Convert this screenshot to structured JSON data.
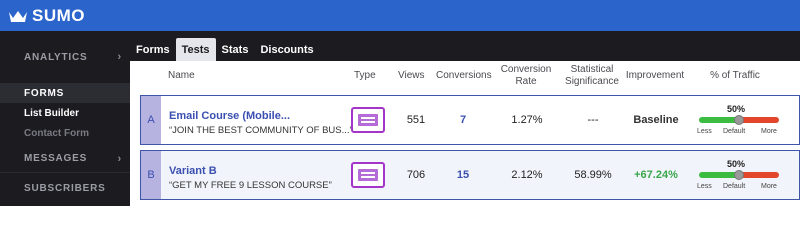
{
  "brand": {
    "name": "SUMO",
    "icon": "crown-icon"
  },
  "sidebar": {
    "analytics": "ANALYTICS",
    "forms": "FORMS",
    "list_builder": "List Builder",
    "contact_form": "Contact Form",
    "messages": "MESSAGES",
    "subscribers": "SUBSCRIBERS"
  },
  "tabs": [
    "Forms",
    "Tests",
    "Stats",
    "Discounts"
  ],
  "active_tab": "Tests",
  "table": {
    "headers": {
      "name": "Name",
      "type": "Type",
      "views": "Views",
      "conversions": "Conversions",
      "conversion_rate": "Conversion Rate",
      "statistical_significance": "Statistical Significance",
      "improvement": "Improvement",
      "traffic": "% of Traffic"
    },
    "rows": [
      {
        "letter": "A",
        "name": "Email Course (Mobile...",
        "subtitle": "“JOIN THE BEST COMMUNITY OF BUS...”",
        "type_icon": "popup-form-icon",
        "views": "551",
        "conversions": "7",
        "conversion_rate": "1.27%",
        "significance": "---",
        "improvement": "Baseline",
        "traffic_pct": "50%",
        "traffic_value": 0.5,
        "slider_labels": {
          "less": "Less",
          "default": "Default",
          "more": "More"
        }
      },
      {
        "letter": "B",
        "name": "Variant B",
        "subtitle": "“GET MY FREE 9 LESSON COURSE”",
        "type_icon": "popup-form-icon",
        "views": "706",
        "conversions": "15",
        "conversion_rate": "2.12%",
        "significance": "58.99%",
        "improvement": "+67.24%",
        "traffic_pct": "50%",
        "traffic_value": 0.5,
        "slider_labels": {
          "less": "Less",
          "default": "Default",
          "more": "More"
        }
      }
    ]
  },
  "colors": {
    "topbar": "#2b65cc",
    "sidebar": "#1b1b20",
    "link": "#3a4fb0",
    "positive": "#3aa54a",
    "slider_green": "#3bbb3f",
    "slider_red": "#e2472c"
  }
}
